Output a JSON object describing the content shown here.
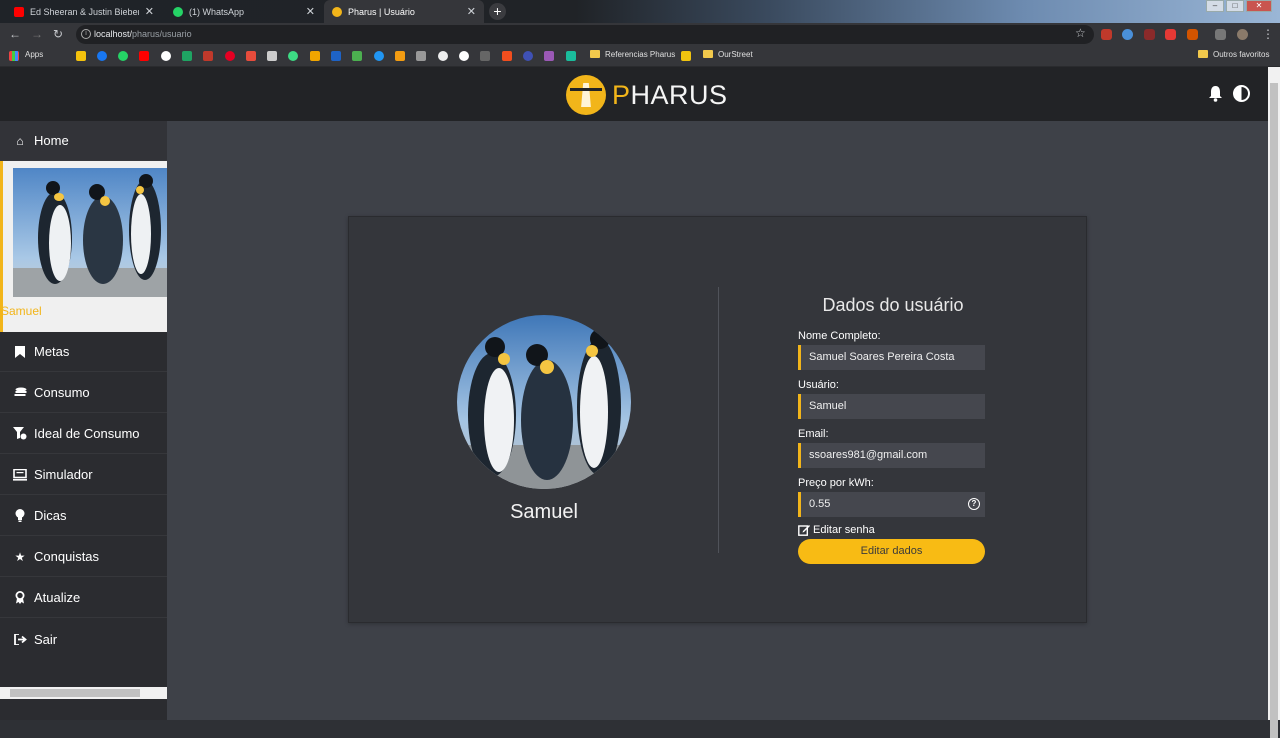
{
  "browser": {
    "tabs": [
      {
        "title": "Ed Sheeran & Justin Bieber - I Do",
        "icon": "youtube-icon",
        "color": "#ff0000"
      },
      {
        "title": "(1) WhatsApp",
        "icon": "whatsapp-icon",
        "color": "#25d366"
      },
      {
        "title": "Pharus | Usuário",
        "icon": "pharus-icon",
        "color": "#f2b51a"
      }
    ],
    "url_host": "localhost/",
    "url_path": "pharus/usuario",
    "bookmarks": {
      "apps": "Apps",
      "referencias": "Referencias Pharus",
      "ourstreet": "OurStreet",
      "outros": "Outros favoritos"
    }
  },
  "header": {
    "logo_initial": "P",
    "logo_rest": "HARUS"
  },
  "sidebar": {
    "home": "Home",
    "profile_name": "Samuel",
    "items": [
      "Metas",
      "Consumo",
      "Ideal de Consumo",
      "Simulador",
      "Dicas",
      "Conquistas",
      "Atualize",
      "Sair"
    ]
  },
  "profile_card": {
    "name": "Samuel",
    "title": "Dados do usuário",
    "full_name_label": "Nome Completo:",
    "full_name": "Samuel Soares Pereira Costa",
    "user_label": "Usuário:",
    "user": "Samuel",
    "email_label": "Email:",
    "email": "ssoares981@gmail.com",
    "price_label": "Preço por kWh:",
    "price": "0.55",
    "edit_password": "Editar senha",
    "edit_button": "Editar dados"
  }
}
